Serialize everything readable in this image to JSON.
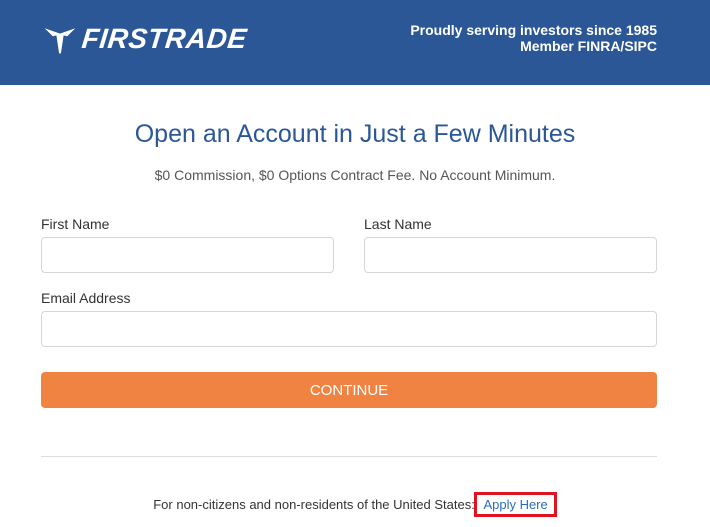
{
  "header": {
    "brand": "FIRSTRADE",
    "tagline_line1": "Proudly serving investors since 1985",
    "tagline_line2": "Member FINRA/SIPC",
    "logo_icon": "firstrade-arrow-icon",
    "bg_color": "#2b5797"
  },
  "main": {
    "title": "Open an Account in Just a Few Minutes",
    "subtitle": "$0 Commission, $0 Options Contract Fee. No Account Minimum."
  },
  "form": {
    "first_name_label": "First Name",
    "first_name_value": "",
    "last_name_label": "Last Name",
    "last_name_value": "",
    "email_label": "Email Address",
    "email_value": "",
    "continue_label": "CONTINUE",
    "continue_color": "#f18342"
  },
  "footer": {
    "noncitizen_text": "For non-citizens and non-residents of the United States:",
    "apply_link": "Apply Here",
    "highlight_color": "#e0141f"
  }
}
